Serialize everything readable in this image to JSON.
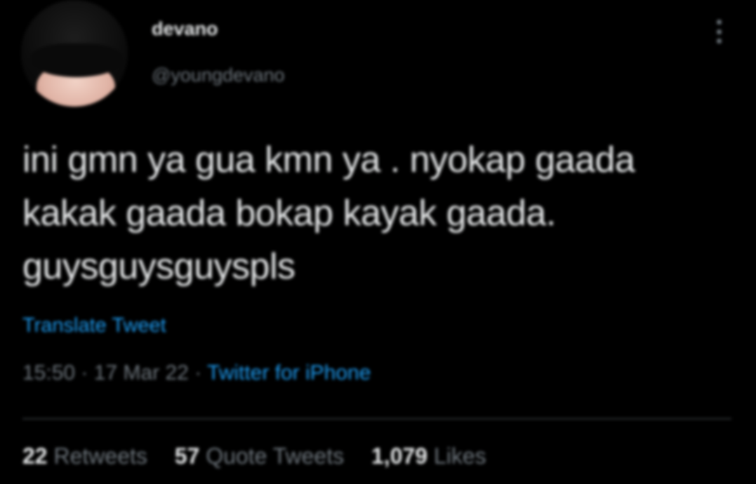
{
  "tweet": {
    "author": {
      "display_name": "devano",
      "handle": "@youngdevano"
    },
    "text": "ini gmn ya gua kmn ya . nyokap gaada kakak gaada bokap kayak gaada. guysguysguyspls",
    "translate_label": "Translate Tweet",
    "time": "15:50",
    "date": "17 Mar 22",
    "separator": "·",
    "source": "Twitter for iPhone",
    "stats": {
      "retweets_count": "22",
      "retweets_label": "Retweets",
      "quotes_count": "57",
      "quotes_label": "Quote Tweets",
      "likes_count": "1,079",
      "likes_label": "Likes"
    }
  },
  "icons": {
    "more": "more-vertical-icon"
  },
  "colors": {
    "background": "#000000",
    "text": "#e7e9ea",
    "secondary": "#6e767d",
    "link": "#1d9bf0",
    "divider": "#2f3336"
  }
}
